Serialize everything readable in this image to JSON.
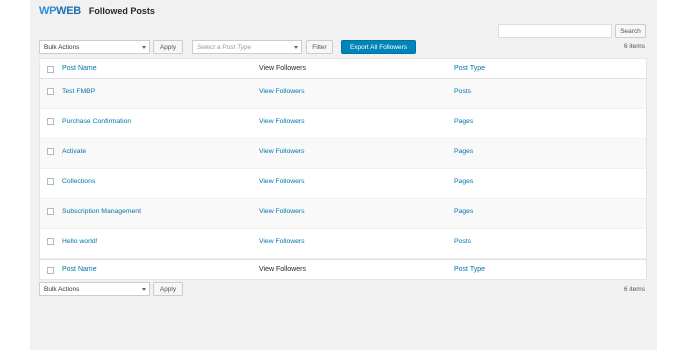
{
  "header": {
    "logo_wp": "WP",
    "logo_web": "WEB",
    "title": "Followed Posts"
  },
  "search": {
    "button": "Search",
    "value": ""
  },
  "top_controls": {
    "bulk_actions": "Bulk Actions",
    "apply": "Apply",
    "post_type_placeholder": "Select a Post Type",
    "filter": "Filter",
    "export": "Export All Followers",
    "count": "6 items"
  },
  "table": {
    "columns": [
      "Post Name",
      "View Followers",
      "Post Type"
    ],
    "rows": [
      {
        "name": "Test FMBP",
        "followers": "View Followers",
        "type": "Posts"
      },
      {
        "name": "Purchase Confirmation",
        "followers": "View Followers",
        "type": "Pages"
      },
      {
        "name": "Activate",
        "followers": "View Followers",
        "type": "Pages"
      },
      {
        "name": "Collections",
        "followers": "View Followers",
        "type": "Pages"
      },
      {
        "name": "Subscription Management",
        "followers": "View Followers",
        "type": "Pages"
      },
      {
        "name": "Hello world!",
        "followers": "View Followers",
        "type": "Posts"
      }
    ]
  },
  "bottom_controls": {
    "bulk_actions": "Bulk Actions",
    "apply": "Apply",
    "count": "6 items"
  },
  "colors": {
    "link": "#0073aa",
    "primary_button": "#0085ba",
    "logo": "#1e6fb3",
    "background": "#f1f1f1"
  }
}
